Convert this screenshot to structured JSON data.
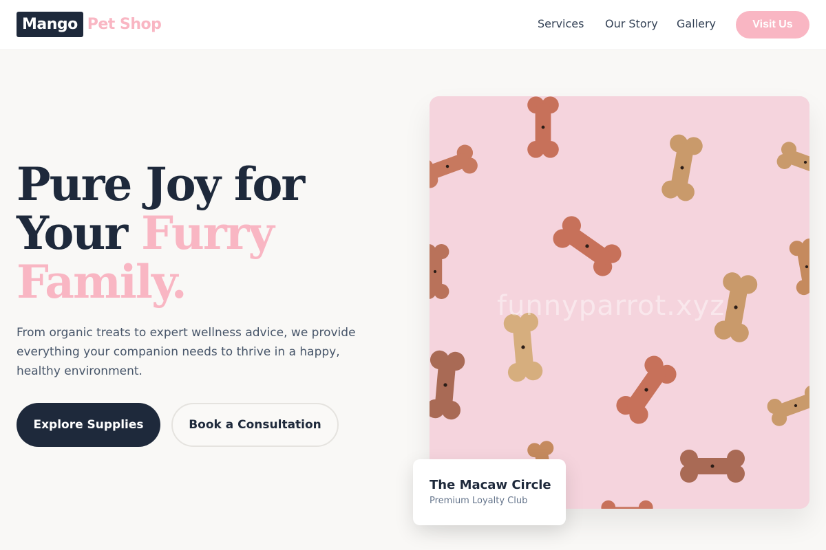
{
  "brand": {
    "logo_box": "Mango",
    "logo_text": "Pet Shop"
  },
  "nav": {
    "items": [
      {
        "label": "Services"
      },
      {
        "label": "Our Story"
      },
      {
        "label": "Gallery"
      }
    ],
    "cta_label": "Visit Us"
  },
  "hero": {
    "headline_line1": "Pure Joy for",
    "headline_line2_a": "Your ",
    "headline_line2_b": "Furry",
    "headline_line3": "Family.",
    "description": "From organic treats to expert wellness advice, we provide everything your companion needs to thrive in a happy, healthy environment.",
    "primary_button": "Explore Supplies",
    "secondary_button": "Book a Consultation"
  },
  "image": {
    "subject": "dog-bone-biscuits-on-pink",
    "watermark": "funnyparrot.xyz"
  },
  "club_card": {
    "title": "The Macaw Circle",
    "subtitle": "Premium Loyalty Club"
  },
  "colors": {
    "navy": "#1e293b",
    "pink": "#f9b6c3",
    "background": "#f9f8f6",
    "image_bg": "#f5d4dd"
  }
}
